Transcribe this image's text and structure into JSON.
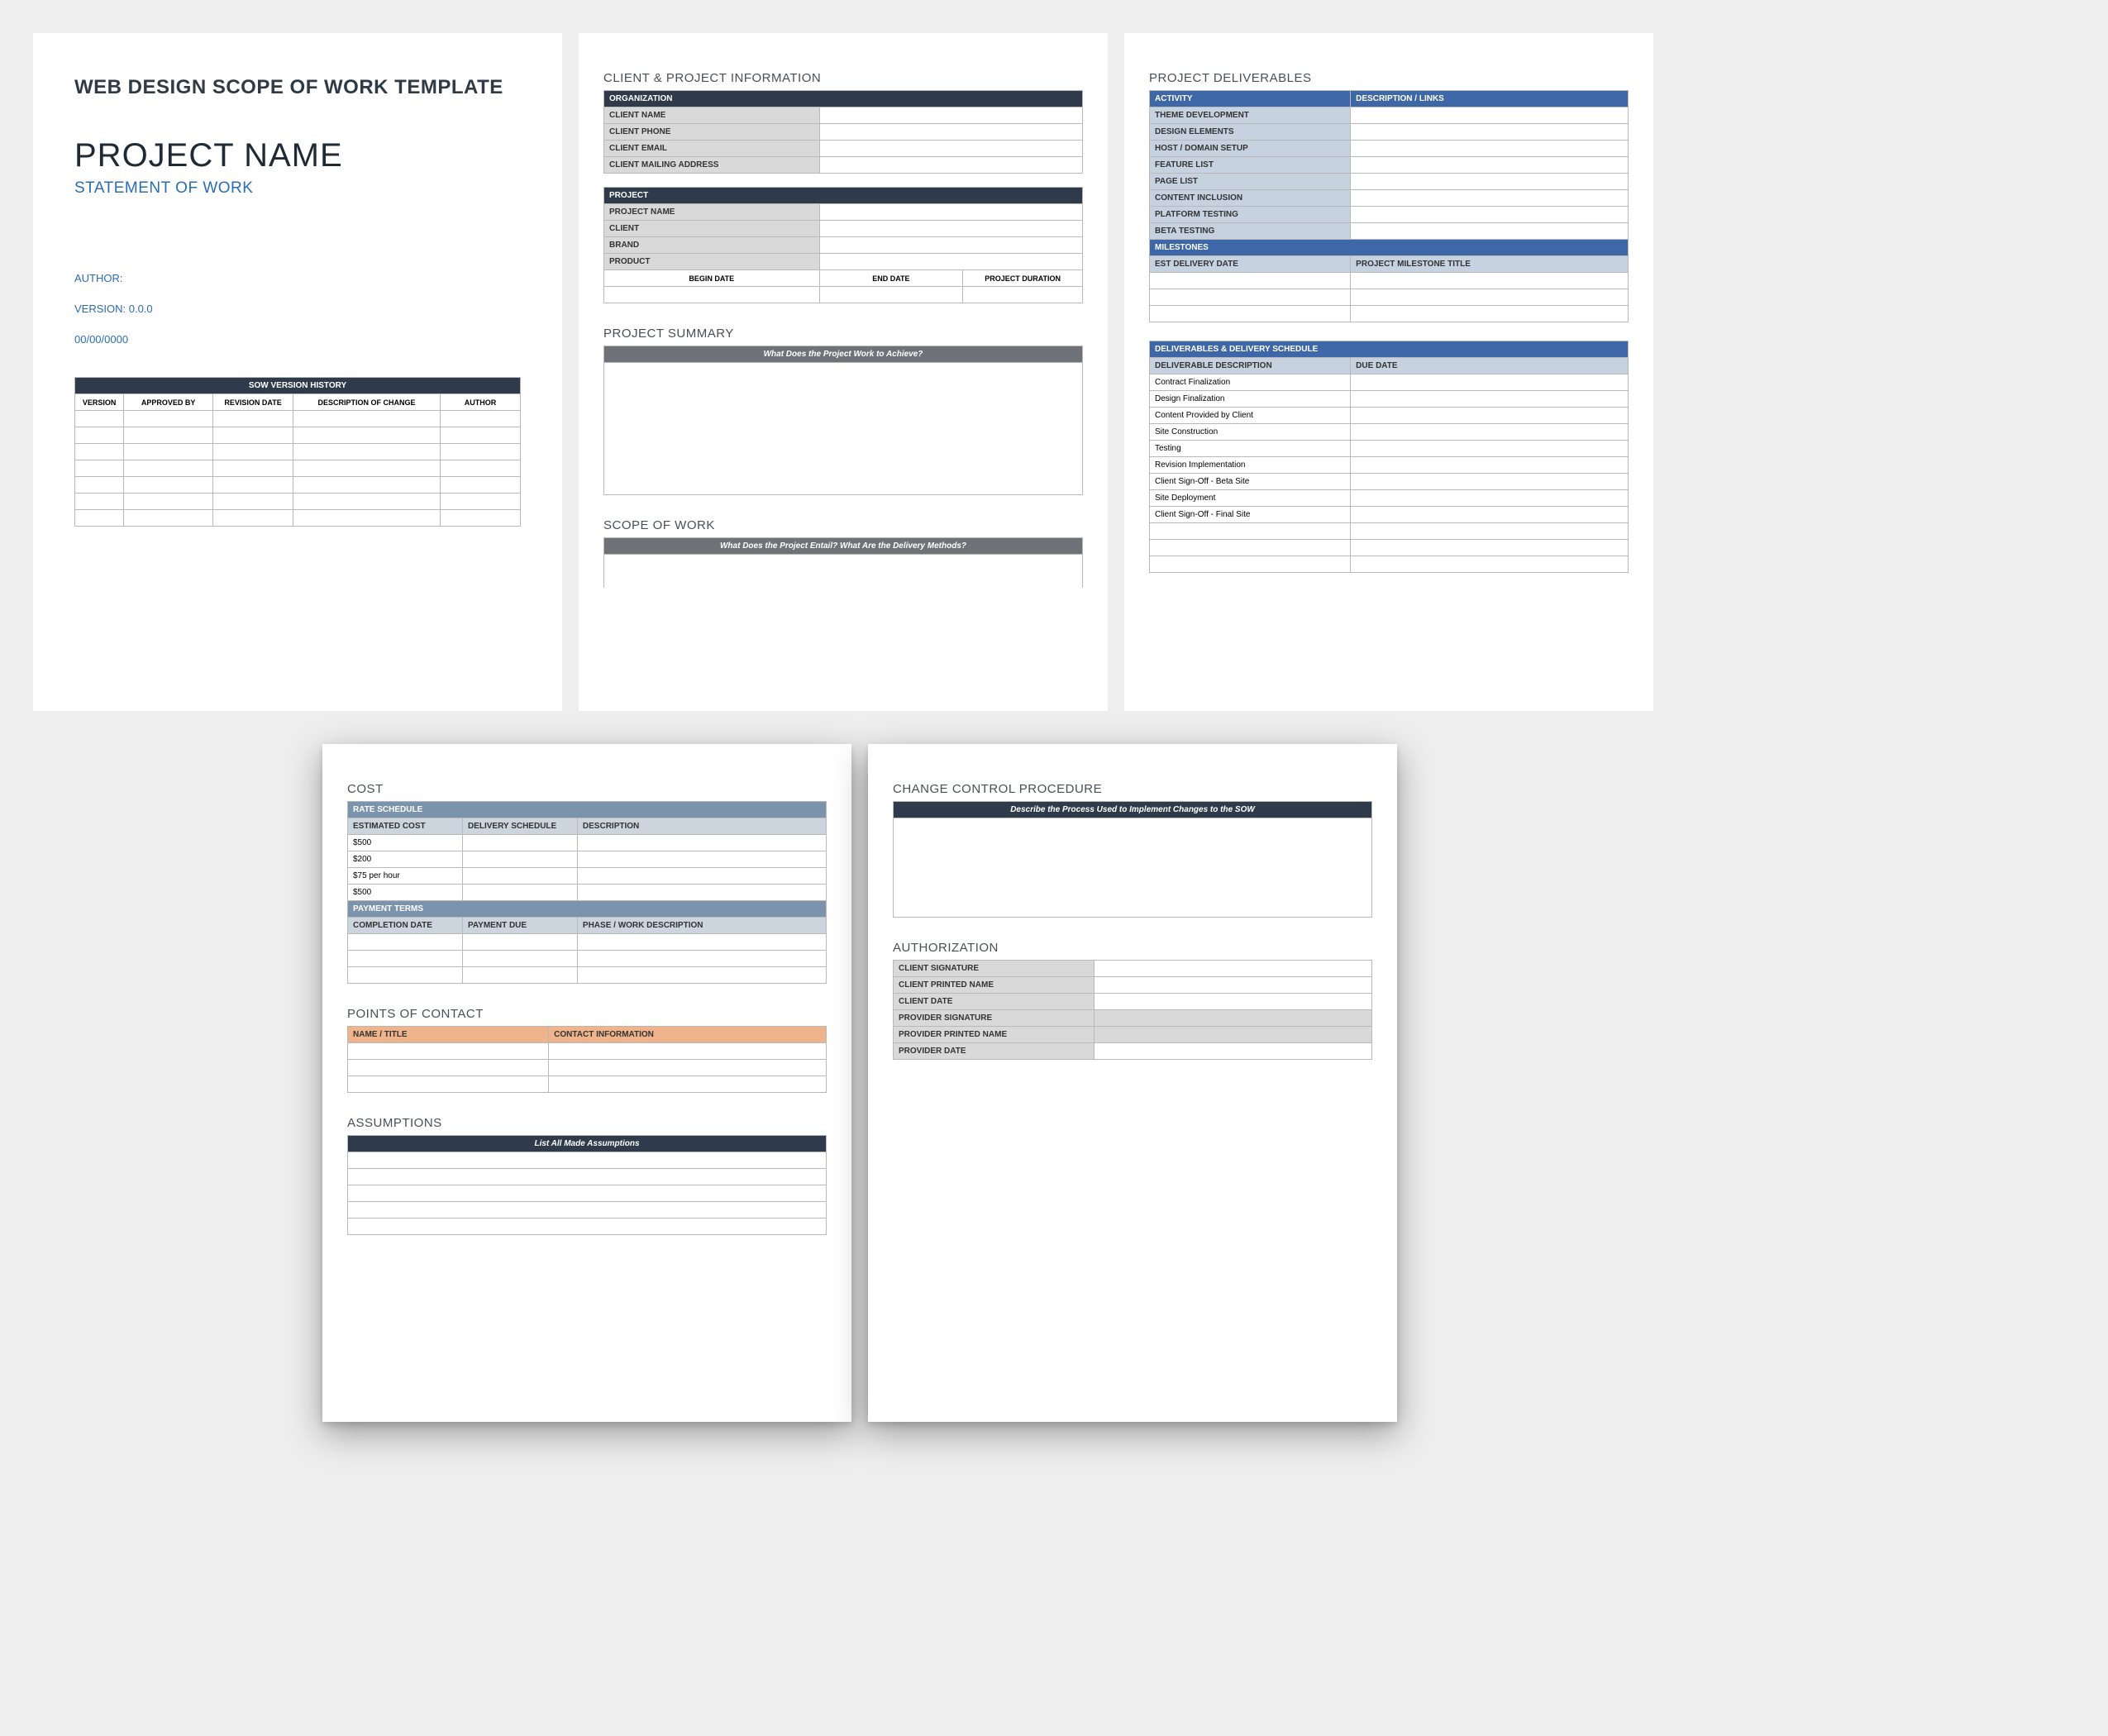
{
  "p1": {
    "tpl_title": "WEB DESIGN SCOPE OF WORK TEMPLATE",
    "project_name": "PROJECT NAME",
    "sow_sub": "STATEMENT OF WORK",
    "author_label": "AUTHOR:",
    "version_label": "VERSION: 0.0.0",
    "date_label": "00/00/0000",
    "history_header": "SOW VERSION HISTORY",
    "history_cols": [
      "VERSION",
      "APPROVED BY",
      "REVISION DATE",
      "DESCRIPTION OF CHANGE",
      "AUTHOR"
    ]
  },
  "p2": {
    "sec_client": "CLIENT & PROJECT INFORMATION",
    "org_header": "ORGANIZATION",
    "org_rows": [
      "CLIENT NAME",
      "CLIENT  PHONE",
      "CLIENT EMAIL",
      "CLIENT MAILING ADDRESS"
    ],
    "proj_header": "PROJECT",
    "proj_rows": [
      "PROJECT NAME",
      "CLIENT",
      "BRAND",
      "PRODUCT"
    ],
    "proj_dates": [
      "BEGIN DATE",
      "END DATE",
      "PROJECT DURATION"
    ],
    "sec_summary": "PROJECT SUMMARY",
    "summary_prompt": "What Does the Project Work to Achieve?",
    "sec_scope": "SCOPE OF WORK",
    "scope_prompt": "What Does the Project Entail? What Are the Delivery Methods?"
  },
  "p3": {
    "sec_deliv": "PROJECT DELIVERABLES",
    "act_cols": [
      "ACTIVITY",
      "DESCRIPTION / LINKS"
    ],
    "act_rows": [
      "THEME DEVELOPMENT",
      "DESIGN ELEMENTS",
      "HOST / DOMAIN SETUP",
      "FEATURE LIST",
      "PAGE LIST",
      "CONTENT INCLUSION",
      "PLATFORM TESTING",
      "BETA TESTING"
    ],
    "mile_header": "MILESTONES",
    "mile_cols": [
      "EST DELIVERY DATE",
      "PROJECT MILESTONE TITLE"
    ],
    "sched_header": "DELIVERABLES & DELIVERY SCHEDULE",
    "sched_cols": [
      "DELIVERABLE DESCRIPTION",
      "DUE DATE"
    ],
    "sched_rows": [
      "Contract Finalization",
      "Design Finalization",
      "Content Provided by Client",
      "Site Construction",
      "Testing",
      "Revision Implementation",
      "Client Sign-Off - Beta Site",
      "Site Deployment",
      "Client Sign-Off - Final Site"
    ]
  },
  "p4": {
    "sec_cost": "COST",
    "rate_header": "RATE SCHEDULE",
    "rate_cols": [
      "ESTIMATED COST",
      "DELIVERY SCHEDULE",
      "DESCRIPTION"
    ],
    "rate_rows": [
      "$500",
      "$200",
      "$75 per hour",
      "$500"
    ],
    "pay_header": "PAYMENT TERMS",
    "pay_cols": [
      "COMPLETION DATE",
      "PAYMENT DUE",
      "PHASE / WORK DESCRIPTION"
    ],
    "sec_contacts": "POINTS OF CONTACT",
    "contact_cols": [
      "NAME / TITLE",
      "CONTACT INFORMATION"
    ],
    "sec_assump": "ASSUMPTIONS",
    "assump_prompt": "List All Made Assumptions"
  },
  "p5": {
    "sec_change": "CHANGE CONTROL PROCEDURE",
    "change_prompt": "Describe the Process Used to Implement Changes to the SOW",
    "sec_auth": "AUTHORIZATION",
    "auth_rows": [
      "CLIENT SIGNATURE",
      "CLIENT PRINTED NAME",
      "CLIENT DATE",
      "PROVIDER SIGNATURE",
      "PROVIDER PRINTED NAME",
      "PROVIDER DATE"
    ]
  }
}
